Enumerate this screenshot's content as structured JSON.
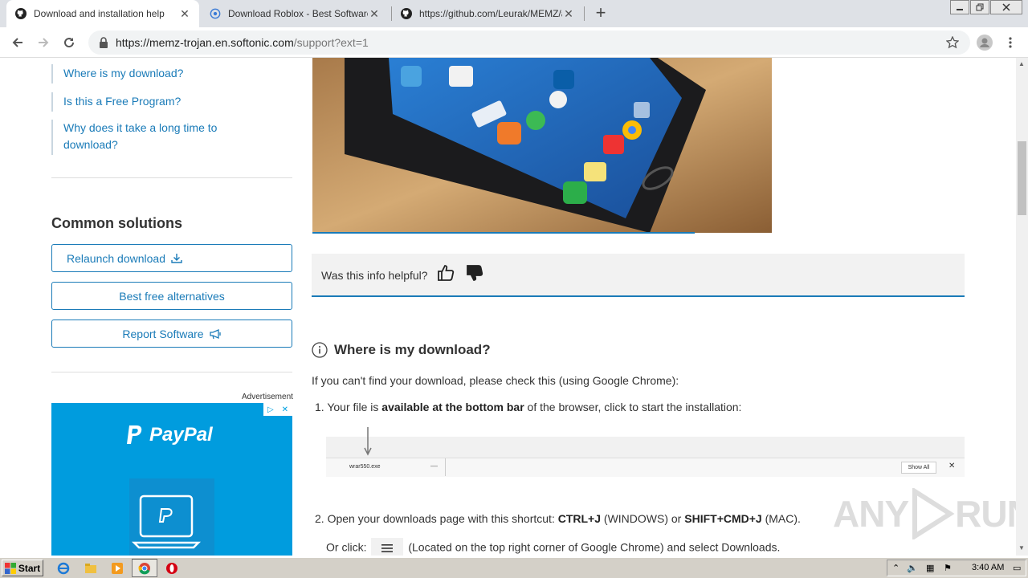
{
  "browser": {
    "tabs": [
      {
        "title": "Download and installation help",
        "active": true,
        "icon": "github-icon"
      },
      {
        "title": "Download Roblox - Best Software &",
        "active": false,
        "icon": "softonic-icon"
      },
      {
        "title": "https://github.com/Leurak/MEMZ/ar",
        "active": false,
        "icon": "github-icon"
      }
    ],
    "new_tab_label": "+",
    "url_host": "https://memz-trojan.en.softonic.com",
    "url_path": "/support?ext=1"
  },
  "sidebar": {
    "toc": [
      {
        "label": "Where is my download?"
      },
      {
        "label": "Is this a Free Program?"
      },
      {
        "label": "Why does it take a long time to download?"
      }
    ],
    "common_solutions_title": "Common solutions",
    "buttons": [
      {
        "label": "Relaunch download"
      },
      {
        "label": "Best free alternatives"
      },
      {
        "label": "Report Software"
      }
    ],
    "advertisement_label": "Advertisement",
    "ad_brand": "PayPal"
  },
  "main": {
    "helpful_question": "Was this info helpful?",
    "section_title": "Where is my download?",
    "intro": "If you can't find your download, please check this (using Google Chrome):",
    "step1_prefix": "1. Your file is ",
    "step1_bold": "available at the bottom bar",
    "step1_suffix": " of the browser, click to start the installation:",
    "download_bar": {
      "filename": "wrar550.exe",
      "show_all": "Show All",
      "close": "✕"
    },
    "step2_prefix": "2. Open your downloads page with this shortcut: ",
    "step2_key1": "CTRL+J",
    "step2_mid1": " (WINDOWS) or ",
    "step2_key2": "SHIFT+CMD+J",
    "step2_suffix": " (MAC).",
    "orclick_prefix": "Or click: ",
    "orclick_suffix": " (Located on the top right corner of Google Chrome) and select Downloads."
  },
  "watermark": {
    "text_left": "ANY",
    "text_right": "RUN"
  },
  "taskbar": {
    "start_label": "Start",
    "clock": "3:40 AM"
  },
  "colors": {
    "link": "#1a7bb8",
    "paypal_bg": "#009cde",
    "tabstrip": "#dee1e6"
  }
}
